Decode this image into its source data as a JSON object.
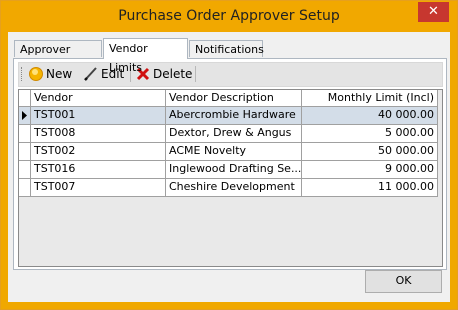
{
  "window": {
    "title": "Purchase Order Approver Setup",
    "close_glyph": "✕"
  },
  "tabs": [
    {
      "label": "Approver Limits",
      "active": false
    },
    {
      "label": "Vendor Limits",
      "active": true
    },
    {
      "label": "Notifications",
      "active": false
    }
  ],
  "toolbar": {
    "new_label": "New",
    "edit_label": "Edit",
    "delete_label": "Delete",
    "new_icon": "new-item-icon",
    "edit_icon": "pencil-icon",
    "delete_icon": "red-x-icon"
  },
  "grid": {
    "columns": [
      "Vendor",
      "Vendor Description",
      "Monthly Limit (Incl)"
    ],
    "rows": [
      [
        "TST001",
        "Abercrombie Hardware",
        "40 000.00"
      ],
      [
        "TST008",
        "Dextor, Drew & Angus",
        "5 000.00"
      ],
      [
        "TST002",
        "ACME Novelty",
        "50 000.00"
      ],
      [
        "TST016",
        "Inglewood Drafting Se...",
        "9 000.00"
      ],
      [
        "TST007",
        "Cheshire Development",
        "11 000.00"
      ]
    ],
    "selected_row": 0
  },
  "footer": {
    "ok_label": "OK"
  },
  "colors": {
    "title_bar": "#f1a800",
    "close": "#c7372f",
    "selected_row": "#d3dde8"
  }
}
